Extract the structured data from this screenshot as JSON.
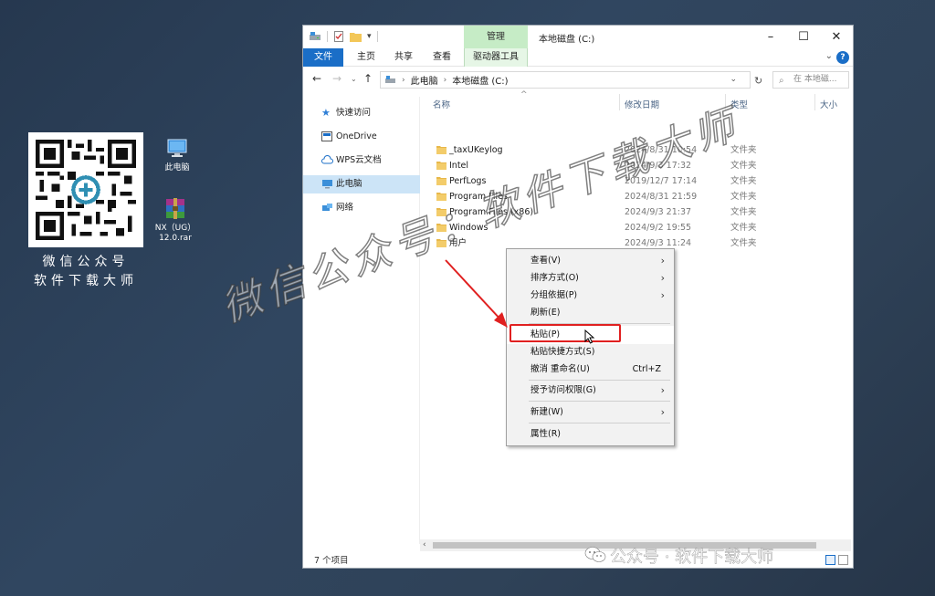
{
  "desktop": {
    "qr_caption_line1": "微信公众号",
    "qr_caption_line2": "软件下载大师",
    "icons": [
      {
        "label": "此电脑",
        "icon": "computer-icon"
      },
      {
        "label": "NX（UG）12.0.rar",
        "icon": "winrar-archive-icon"
      }
    ]
  },
  "window": {
    "title": "本地磁盘 (C:)",
    "contextual_tab_group": "管理",
    "controls": {
      "minimize": "–",
      "maximize": "☐",
      "close": "✕"
    },
    "ribbon_tabs": [
      "文件",
      "主页",
      "共享",
      "查看",
      "驱动器工具"
    ],
    "address": {
      "segments": [
        "此电脑",
        "本地磁盘 (C:)"
      ]
    },
    "search_placeholder": "在 本地磁...",
    "nav_pane": [
      {
        "label": "快速访问",
        "icon": "star-icon"
      },
      {
        "label": "OneDrive",
        "icon": "onedrive-icon"
      },
      {
        "label": "WPS云文档",
        "icon": "cloud-icon"
      },
      {
        "label": "此电脑",
        "icon": "computer-icon",
        "selected": true
      },
      {
        "label": "网络",
        "icon": "network-icon"
      }
    ],
    "columns": [
      "名称",
      "修改日期",
      "类型",
      "大小"
    ],
    "files": [
      {
        "name": "_taxUKeylog",
        "date": "2024/8/31 10:54",
        "type": "文件夹"
      },
      {
        "name": "Intel",
        "date": "2024/9/3 17:32",
        "type": "文件夹"
      },
      {
        "name": "PerfLogs",
        "date": "2019/12/7 17:14",
        "type": "文件夹"
      },
      {
        "name": "Program Files",
        "date": "2024/8/31 21:59",
        "type": "文件夹"
      },
      {
        "name": "Program Files (x86)",
        "date": "2024/9/3 21:37",
        "type": "文件夹"
      },
      {
        "name": "Windows",
        "date": "2024/9/2 19:55",
        "type": "文件夹"
      },
      {
        "name": "用户",
        "date": "2024/9/3 11:24",
        "type": "文件夹"
      }
    ],
    "status": "7 个项目"
  },
  "context_menu": {
    "items": [
      {
        "label": "查看(V)",
        "submenu": true
      },
      {
        "label": "排序方式(O)",
        "submenu": true
      },
      {
        "label": "分组依据(P)",
        "submenu": true
      },
      {
        "label": "刷新(E)"
      },
      {
        "separator": true
      },
      {
        "label": "粘贴(P)",
        "hover": true
      },
      {
        "label": "粘贴快捷方式(S)"
      },
      {
        "label": "撤消 重命名(U)",
        "shortcut": "Ctrl+Z"
      },
      {
        "separator": true
      },
      {
        "label": "授予访问权限(G)",
        "submenu": true
      },
      {
        "separator": true
      },
      {
        "label": "新建(W)",
        "submenu": true
      },
      {
        "separator": true
      },
      {
        "label": "属性(R)"
      }
    ]
  },
  "watermark": {
    "diagonal": "微信公众号：软件下载大师",
    "bottom": "公众号 · 软件下载大师"
  },
  "colors": {
    "file_tab": "#1a6ec7",
    "manage_tab": "#c6ecc6",
    "selected_nav": "#cce4f7",
    "highlight_box": "#e02020",
    "folder": "#e8b84a"
  }
}
